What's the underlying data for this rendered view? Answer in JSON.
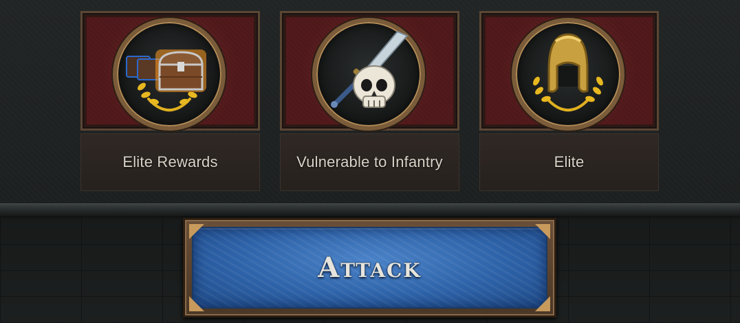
{
  "traits": [
    {
      "label": "Elite Rewards",
      "icon": "treasure-chest-icon"
    },
    {
      "label": "Vulnerable to Infantry",
      "icon": "skull-sword-icon"
    },
    {
      "label": "Elite",
      "icon": "golden-helmet-icon"
    }
  ],
  "attack_button": {
    "label": "Attack"
  },
  "colors": {
    "card_red": "#5a1c1e",
    "frame_bronze": "#7a5c3a",
    "button_blue": "#2d62a8",
    "laurel_gold": "#e0b020"
  }
}
